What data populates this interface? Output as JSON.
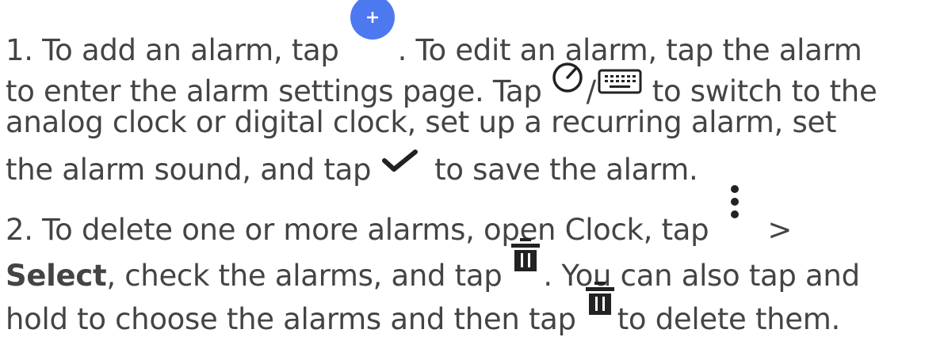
{
  "instructions": {
    "step1": {
      "l1_a": "1. To add an alarm, tap",
      "l1_b": ". To edit an alarm, tap the alarm",
      "l2_a": "to enter the alarm settings page. Tap",
      "l2_slash": "/",
      "l2_b": "to switch to the",
      "l3": "analog clock or digital clock, set up a recurring alarm, set",
      "l4_a": "the alarm sound, and tap",
      "l4_b": "to save the alarm."
    },
    "step2": {
      "l5_a": "2. To delete one or more alarms, open Clock, tap",
      "l5_b": ">",
      "l6_bold": "Select",
      "l6_a": ", check the alarms, and tap",
      "l6_b": ". You can also tap and",
      "l7_a": "hold to choose the alarms and then tap",
      "l7_b": "to delete them."
    }
  },
  "icons": {
    "add": "plus-icon",
    "analog_clock": "clock-icon",
    "digital_clock": "keyboard-icon",
    "save": "check-icon",
    "more": "more-vertical-icon",
    "delete": "trash-icon"
  },
  "colors": {
    "text": "#444444",
    "add_button_fill": "#4d79f0",
    "icon_dark": "#222222"
  }
}
